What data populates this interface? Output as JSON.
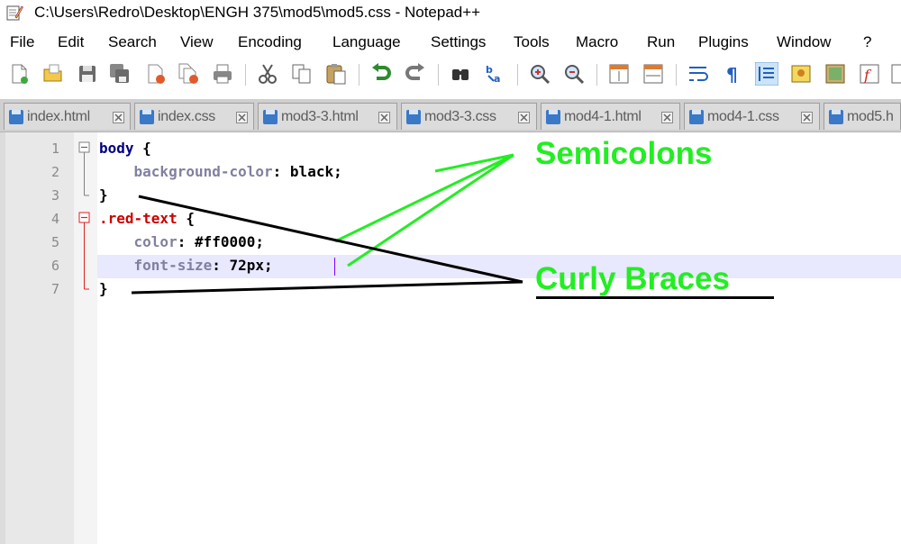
{
  "window": {
    "title": "C:\\Users\\Redro\\Desktop\\ENGH 375\\mod5\\mod5.css - Notepad++",
    "app_icon": "notepad-icon"
  },
  "menu": {
    "items": [
      "File",
      "Edit",
      "Search",
      "View",
      "Encoding",
      "Language",
      "Settings",
      "Tools",
      "Macro",
      "Run",
      "Plugins",
      "Window",
      "?"
    ]
  },
  "toolbar": {
    "icons": [
      "new-file-icon",
      "open-file-icon",
      "save-icon",
      "save-all-icon",
      "close-icon",
      "close-all-icon",
      "print-icon",
      "cut-icon",
      "copy-icon",
      "paste-icon",
      "undo-icon",
      "redo-icon",
      "find-icon",
      "replace-icon",
      "zoom-in-icon",
      "zoom-out-icon",
      "sync-vertical-icon",
      "sync-horizontal-icon",
      "word-wrap-icon",
      "show-all-chars-icon",
      "indent-guide-icon",
      "user-language-icon",
      "doc-map-icon",
      "function-list-icon",
      "folder-as-workspace-icon"
    ]
  },
  "tabs": [
    {
      "label": "index.html"
    },
    {
      "label": "index.css"
    },
    {
      "label": "mod3-3.html"
    },
    {
      "label": "mod3-3.css"
    },
    {
      "label": "mod4-1.html"
    },
    {
      "label": "mod4-1.css"
    },
    {
      "label": "mod5.h"
    }
  ],
  "editor": {
    "line_numbers": [
      "1",
      "2",
      "3",
      "4",
      "5",
      "6",
      "7"
    ],
    "lines": {
      "l1": {
        "selector": "body",
        "brace": " {"
      },
      "l2": {
        "property": "background-color",
        "colon": ": ",
        "value": "black",
        "semi": ";"
      },
      "l3": {
        "brace": "}"
      },
      "l4": {
        "selector": ".red-text",
        "brace": " {"
      },
      "l5": {
        "property": "color",
        "colon": ": ",
        "value": "#ff0000",
        "semi": ";"
      },
      "l6": {
        "property": "font-size",
        "colon": ": ",
        "value": "72px",
        "semi": ";"
      },
      "l7": {
        "brace": "}"
      }
    },
    "current_line": 6
  },
  "annotations": {
    "semicolons": "Semicolons",
    "curly_braces": "Curly Braces",
    "arrow_color": "#22ee22",
    "brace_arrow_color": "#000000"
  }
}
